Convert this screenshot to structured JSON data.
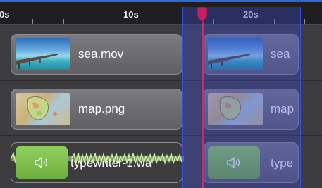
{
  "ruler": {
    "labels": [
      "0s",
      "10s",
      "20s"
    ]
  },
  "tracks": {
    "video_clip_label": "sea.mov",
    "image_clip_label": "map.png",
    "audio_clip_label": "typewriter-1.wa"
  },
  "selection": {
    "video_clip_label": "sea",
    "image_clip_label": "map",
    "audio_clip_label": "type"
  },
  "icons": {
    "audio": "speaker-icon",
    "playhead": "playhead-icon"
  },
  "colors": {
    "playhead": "#d0286a",
    "selection": "#3b4fd9",
    "audio_accent": "#8fcf5e",
    "ruler_accent": "#2f6bd8"
  }
}
